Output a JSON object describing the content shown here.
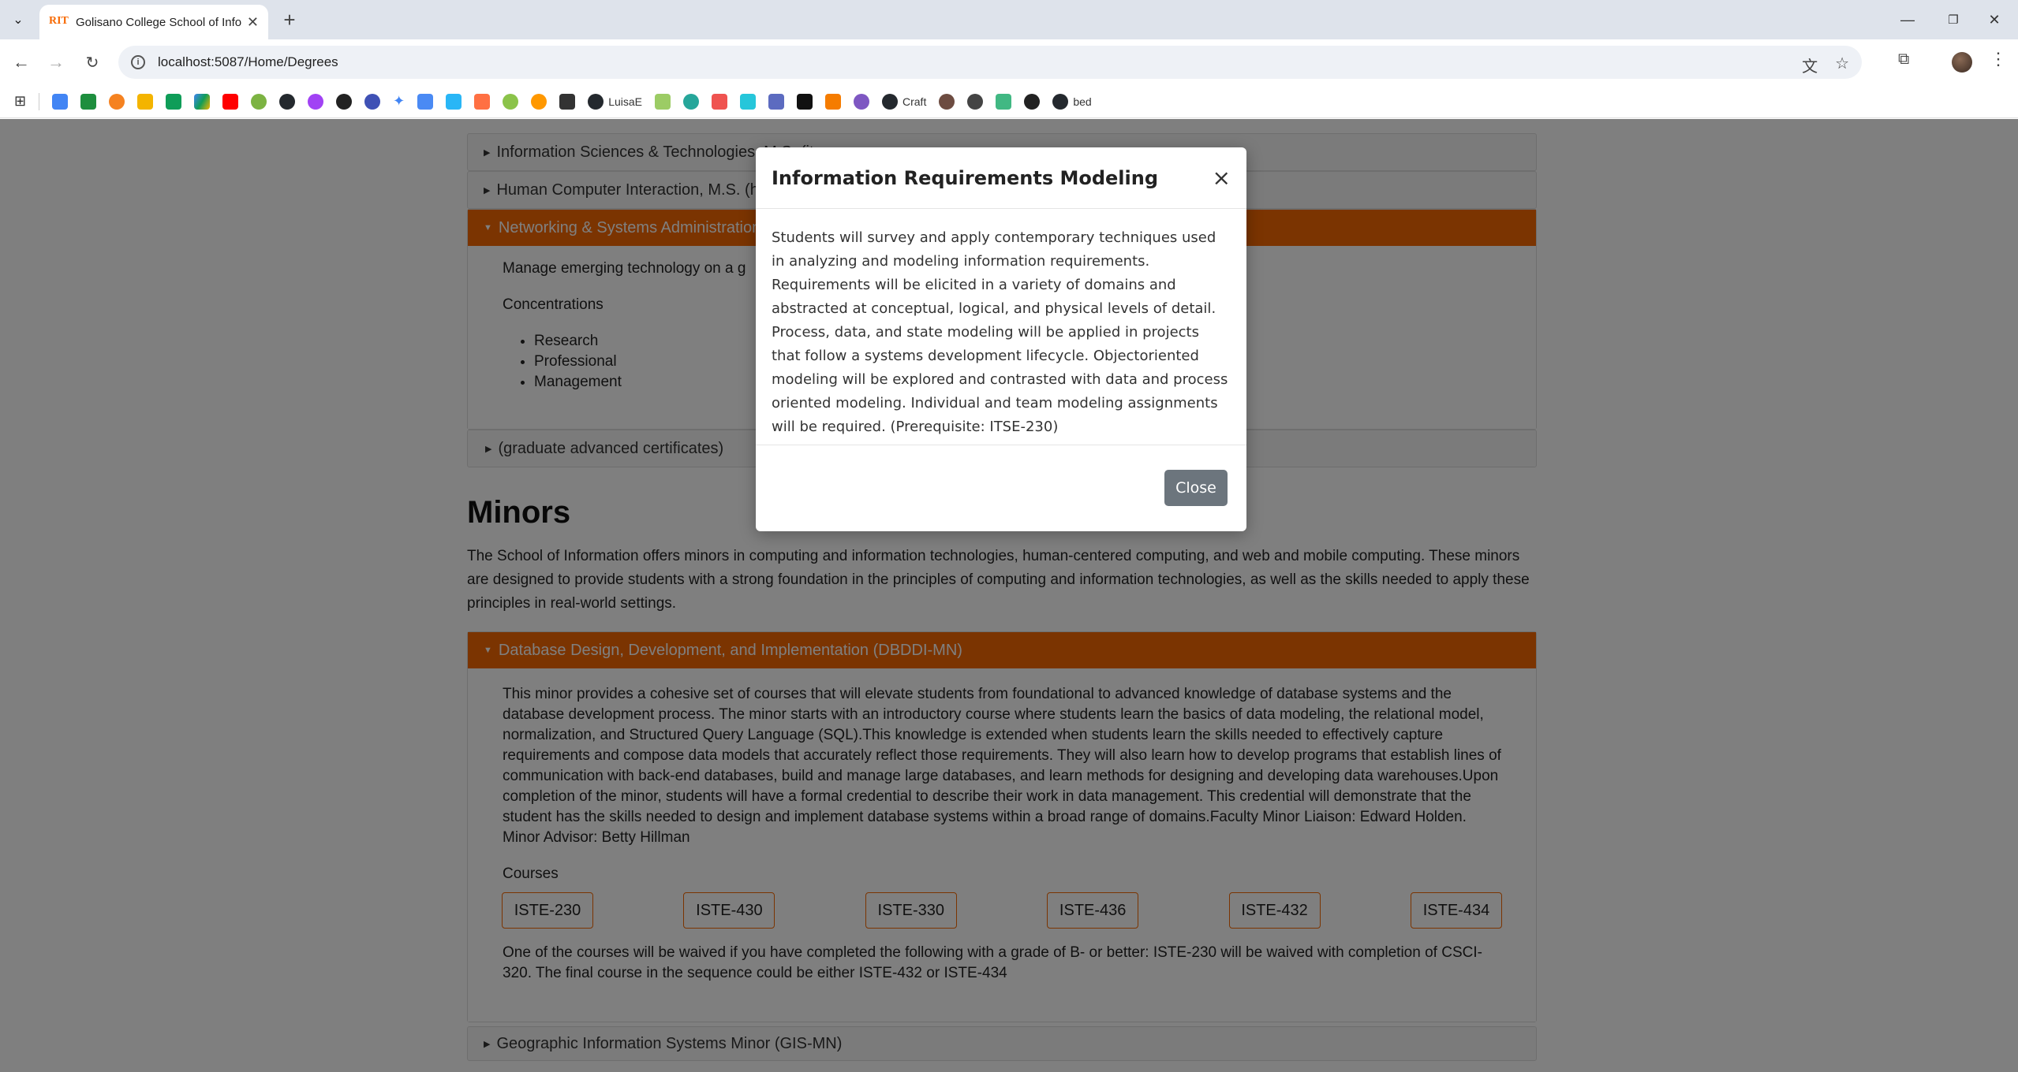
{
  "browser": {
    "tab_title": "Golisano College School of Info",
    "tab_favicon": "RIT",
    "url": "localhost:5087/Home/Degrees",
    "bookmarks": [
      "LuisaE",
      "Craft",
      "bed"
    ]
  },
  "accordions_top": [
    {
      "label": "Information Sciences & Technologies, M.S. (it..."
    },
    {
      "label": "Human Computer Interaction, M.S. (h"
    },
    {
      "label": "Networking & Systems Administration"
    }
  ],
  "networking": {
    "description": "Manage emerging technology on a g",
    "concentrations_label": "Concentrations",
    "concentrations": [
      "Research",
      "Professional",
      "Management"
    ]
  },
  "certificates_label": "(graduate advanced certificates)",
  "minors": {
    "title": "Minors",
    "intro": "The School of Information offers minors in computing and information technologies, human-centered computing, and web and mobile computing. These minors are designed to provide students with a strong foundation in the principles of computing and information technologies, as well as the skills needed to apply these principles in real-world settings.",
    "dbddi": {
      "label": "Database Design, Development, and Implementation (DBDDI-MN)",
      "description": "This minor provides a cohesive set of courses that will elevate students from foundational to advanced knowledge of database systems and the database development process. The minor starts with an introductory course where students learn the basics of data modeling, the relational model, normalization, and Structured Query Language (SQL).This knowledge is extended when students learn the skills needed to effectively capture requirements and compose data models that accurately reflect those requirements. They will also learn how to develop programs that establish lines of communication with back-end databases, build and manage large databases, and learn methods for designing and developing data warehouses.Upon completion of the minor, students will have a formal credential to describe their work in data management. This credential will demonstrate that the student has the skills needed to design and implement database systems within a broad range of domains.Faculty Minor Liaison: Edward Holden. Minor Advisor: Betty Hillman",
      "courses_label": "Courses",
      "courses": [
        "ISTE-230",
        "ISTE-430",
        "ISTE-330",
        "ISTE-436",
        "ISTE-432",
        "ISTE-434"
      ],
      "note": "One of the courses will be waived if you have completed the following with a grade of B- or better: ISTE-230 will be waived with completion of CSCI-320. The final course in the sequence could be either ISTE-432 or ISTE-434"
    },
    "gis": {
      "label": "Geographic Information Systems Minor (GIS-MN)"
    }
  },
  "modal": {
    "title": "Information Requirements Modeling",
    "close_x": "×",
    "body": "Students will survey and apply contemporary techniques used in analyzing and modeling information requirements. Requirements will be elicited in a variety of domains and abstracted at conceptual, logical, and physical levels of detail. Process, data, and state modeling will be applied in projects that follow a systems development lifecycle. Objectoriented modeling will be explored and contrasted with data and process oriented modeling. Individual and team modeling assignments will be required. (Prerequisite: ITSE-230)",
    "close_button": "Close"
  },
  "colors": {
    "accent": "#f76902",
    "close_button": "#6c757d"
  }
}
